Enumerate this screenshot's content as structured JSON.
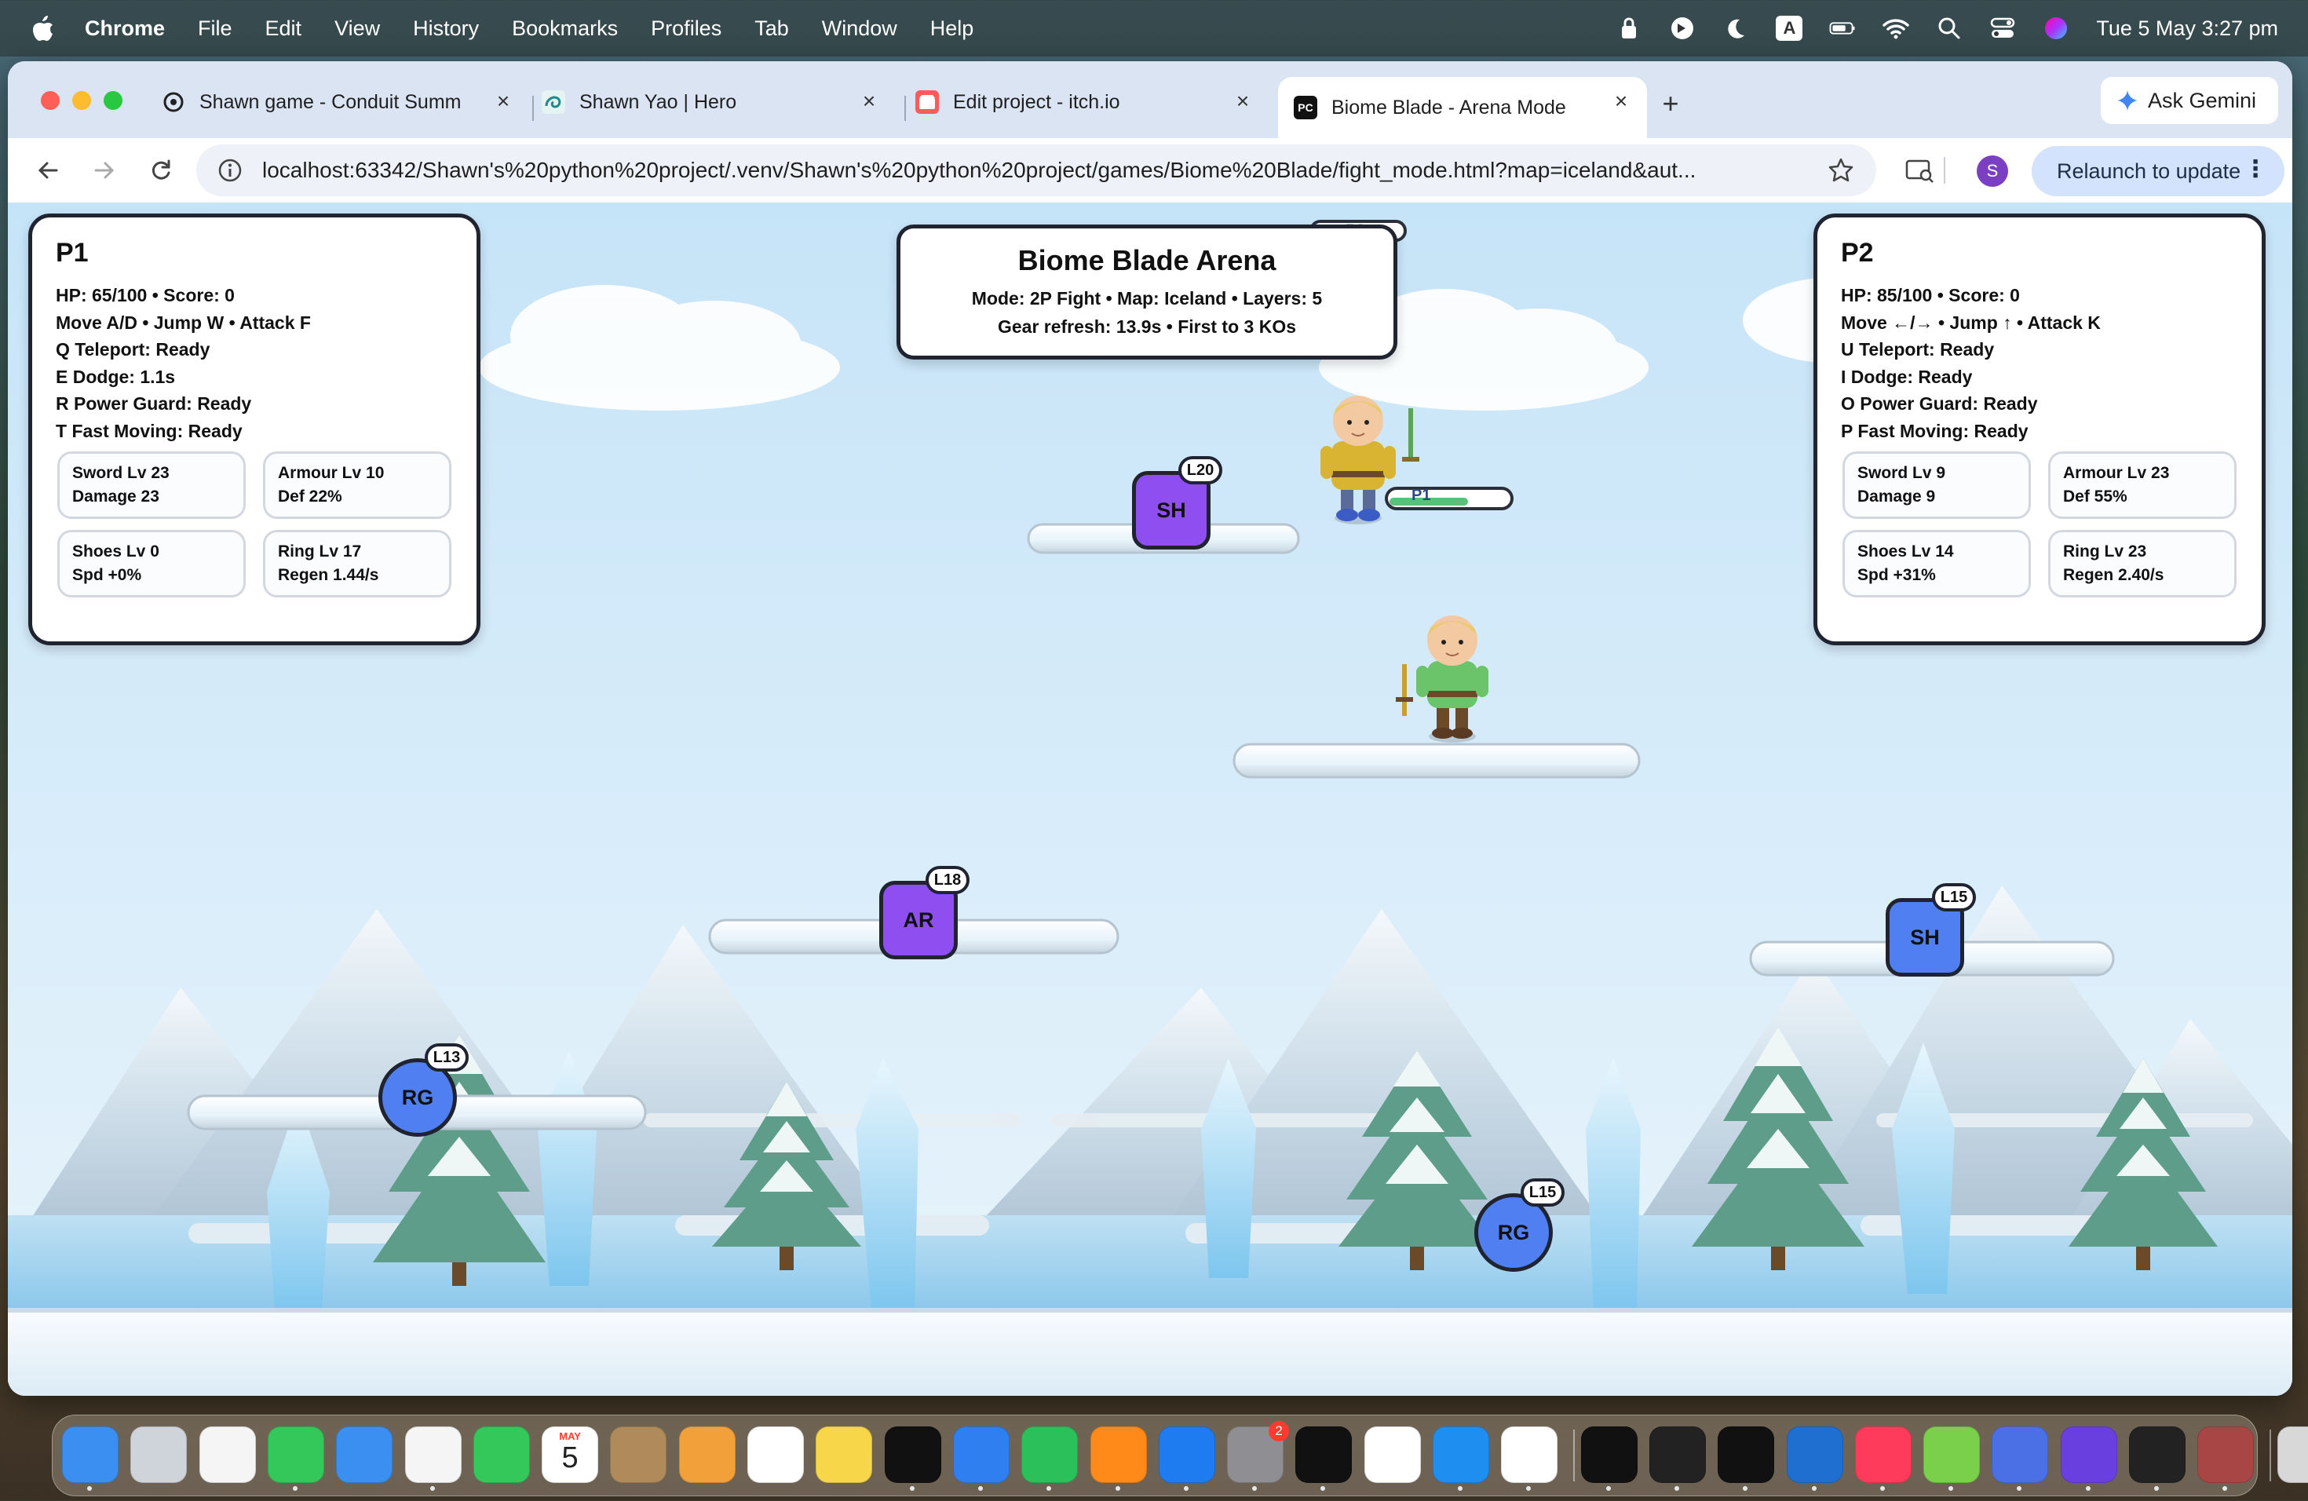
{
  "menubar": {
    "app_name": "Chrome",
    "menus": [
      "File",
      "Edit",
      "View",
      "History",
      "Bookmarks",
      "Profiles",
      "Tab",
      "Window",
      "Help"
    ],
    "datetime": "Tue 5 May  3:27 pm",
    "input_source": "A"
  },
  "browser": {
    "tabs": [
      {
        "title": "Shawn game - Conduit Summ",
        "icon": "openai-icon",
        "active": false
      },
      {
        "title": "Shawn Yao | Hero",
        "icon": "swirl-site-icon",
        "active": false
      },
      {
        "title": "Edit project - itch.io",
        "icon": "itchio-icon",
        "active": false
      },
      {
        "title": "Biome Blade - Arena Mode",
        "icon": "pycharm-icon",
        "active": true
      }
    ],
    "ask_gemini": "Ask Gemini",
    "url": "localhost:63342/Shawn's%20python%20project/.venv/Shawn's%20python%20project/games/Biome%20Blade/fight_mode.html?map=iceland&aut...",
    "profile_initial": "S",
    "relaunch": "Relaunch to update"
  },
  "game": {
    "p1": {
      "title": "P1",
      "lines": [
        "HP: 65/100 • Score: 0",
        "Move A/D • Jump W • Attack F",
        "Q Teleport: Ready",
        "E Dodge: 1.1s",
        "R Power Guard: Ready",
        "T Fast Moving: Ready"
      ],
      "gear": [
        {
          "line1": "Sword Lv 23",
          "line2": "Damage 23"
        },
        {
          "line1": "Armour Lv 10",
          "line2": "Def 22%"
        },
        {
          "line1": "Shoes Lv 0",
          "line2": "Spd +0%"
        },
        {
          "line1": "Ring Lv 17",
          "line2": "Regen 1.44/s"
        }
      ]
    },
    "p2": {
      "title": "P2",
      "lines": [
        "HP: 85/100 • Score: 0",
        "Move ←/→ • Jump ↑ • Attack K",
        "U Teleport: Ready",
        "I Dodge: Ready",
        "O Power Guard: Ready",
        "P Fast Moving: Ready"
      ],
      "gear": [
        {
          "line1": "Sword Lv 9",
          "line2": "Damage 9"
        },
        {
          "line1": "Armour Lv 23",
          "line2": "Def 55%"
        },
        {
          "line1": "Shoes Lv 14",
          "line2": "Spd +31%"
        },
        {
          "line1": "Ring Lv 23",
          "line2": "Regen 2.40/s"
        }
      ]
    },
    "header": {
      "title": "Biome Blade Arena",
      "info1": "Mode: 2P Fight • Map: Iceland • Layers: 5",
      "info2": "Gear refresh: 13.9s • First to 3 KOs"
    },
    "player_tags": {
      "p1": "P1",
      "p2": "P2"
    },
    "gear_pickups": [
      {
        "code": "SH",
        "level": "L20",
        "shape": "square",
        "color": "#8f4ef0"
      },
      {
        "code": "AR",
        "level": "L18",
        "shape": "square",
        "color": "#8f4ef0"
      },
      {
        "code": "SH",
        "level": "L15",
        "shape": "square",
        "color": "#4f7ff0"
      },
      {
        "code": "RG",
        "level": "L13",
        "shape": "round",
        "color": "#4f7ff0"
      },
      {
        "code": "RG",
        "level": "L15",
        "shape": "round",
        "color": "#4f7ff0"
      }
    ]
  },
  "dock": {
    "apps": [
      "Finder",
      "Launchpad",
      "Freeform",
      "Messages",
      "Mail",
      "Photos",
      "FaceTime",
      "Calendar",
      "Contacts",
      "Pages",
      "Reminders",
      "Notes",
      "TV",
      "Keynote",
      "Numbers",
      "Sublime Text",
      "App Store",
      "System Settings",
      "Terminal",
      "Cloud",
      "Safari",
      "Chrome",
      "PyCharm",
      "Inkscape",
      "Activity Monitor",
      "VS Code",
      "Music",
      "App",
      "Preview",
      "iMovie",
      "Tunnel",
      "Dictionary",
      "Trash"
    ],
    "calendar_month": "MAY",
    "calendar_day": "5",
    "settings_badge": "2"
  }
}
